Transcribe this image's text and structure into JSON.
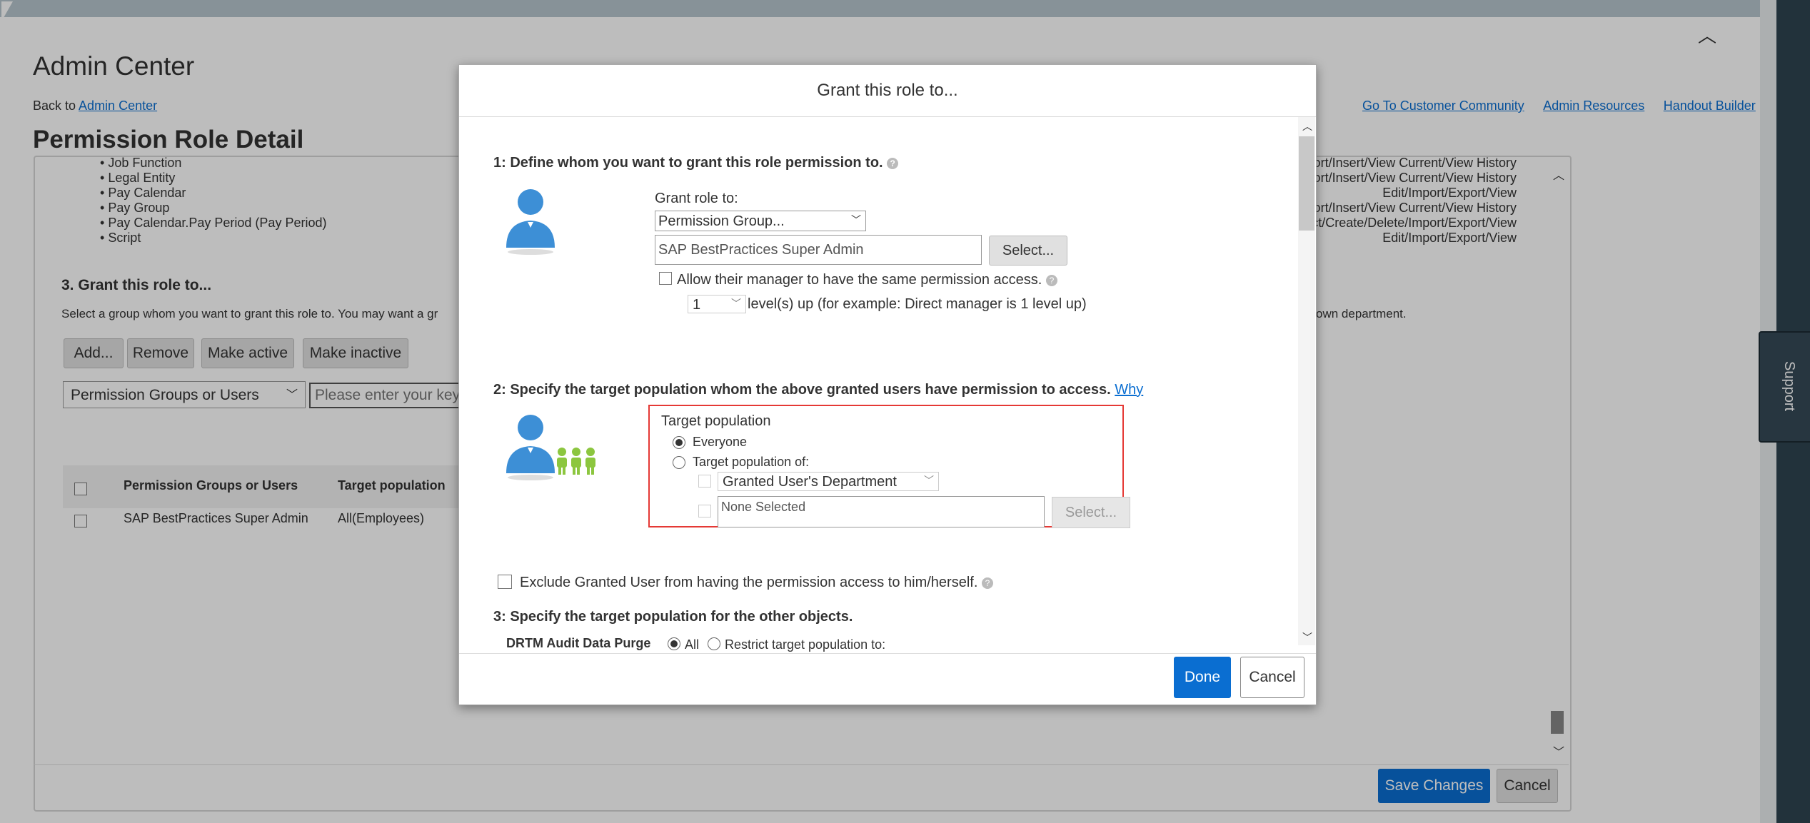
{
  "background": {
    "app_title": "Admin Center",
    "back_prefix": "Back to",
    "back_link": "Admin Center",
    "header_links": [
      "Go To Customer Community",
      "Admin Resources",
      "Handout Builder"
    ],
    "page_title": "Permission Role Detail",
    "list_items": [
      "Job Function",
      "Legal Entity",
      "Pay Calendar",
      "Pay Group",
      "Pay Calendar.Pay Period (Pay Period)",
      "Script"
    ],
    "right_perms": [
      "port/Insert/View Current/View History",
      "port/Insert/View Current/View History",
      "Edit/Import/Export/View",
      "port/Insert/View Current/View History",
      "ct/Create/Delete/Import/Export/View",
      "Edit/Import/Export/View"
    ],
    "grant_heading": "3. Grant this role to...",
    "grant_desc_left": "Select a group whom you want to grant this role to. You may want a gr",
    "grant_desc_right": "own department.",
    "buttons": [
      "Add...",
      "Remove",
      "Make active",
      "Make inactive"
    ],
    "filter_select": "Permission Groups or Users",
    "search_placeholder": "Please enter your keyw",
    "table_headers": [
      "Permission Groups or Users",
      "Target population"
    ],
    "table_row": [
      "SAP BestPractices Super Admin",
      "All(Employees)"
    ],
    "save_changes": "Save Changes",
    "cancel": "Cancel",
    "support": "Support"
  },
  "dialog": {
    "title": "Grant this role to...",
    "step1": "1: Define whom you want to grant this role permission to.",
    "grant_role_to": "Grant role to:",
    "grant_type": "Permission Group...",
    "grant_value": "SAP BestPractices Super Admin",
    "select_btn": "Select...",
    "allow_manager": "Allow their manager to have the same permission access.",
    "level_value": "1",
    "level_text": "level(s) up (for example: Direct manager is 1 level up)",
    "step2": "2: Specify the target population whom the above granted users have permission to access.",
    "why": "Why",
    "target_population": "Target population",
    "everyone": "Everyone",
    "target_of": "Target population of:",
    "dept_select": "Granted User's Department",
    "none_selected": "None Selected",
    "select_disabled": "Select...",
    "exclude": "Exclude Granted User from having the permission access to him/herself.",
    "step3": "3: Specify the target population for the other objects.",
    "drtm_label": "DRTM Audit Data Purge",
    "all": "All",
    "restrict": "Restrict target population to:",
    "done": "Done",
    "cancel": "Cancel"
  },
  "colors": {
    "accent": "#0a6ed1",
    "highlight_border": "#e53935",
    "icon_blue": "#3d8fd6",
    "icon_green": "#8cc63f"
  }
}
